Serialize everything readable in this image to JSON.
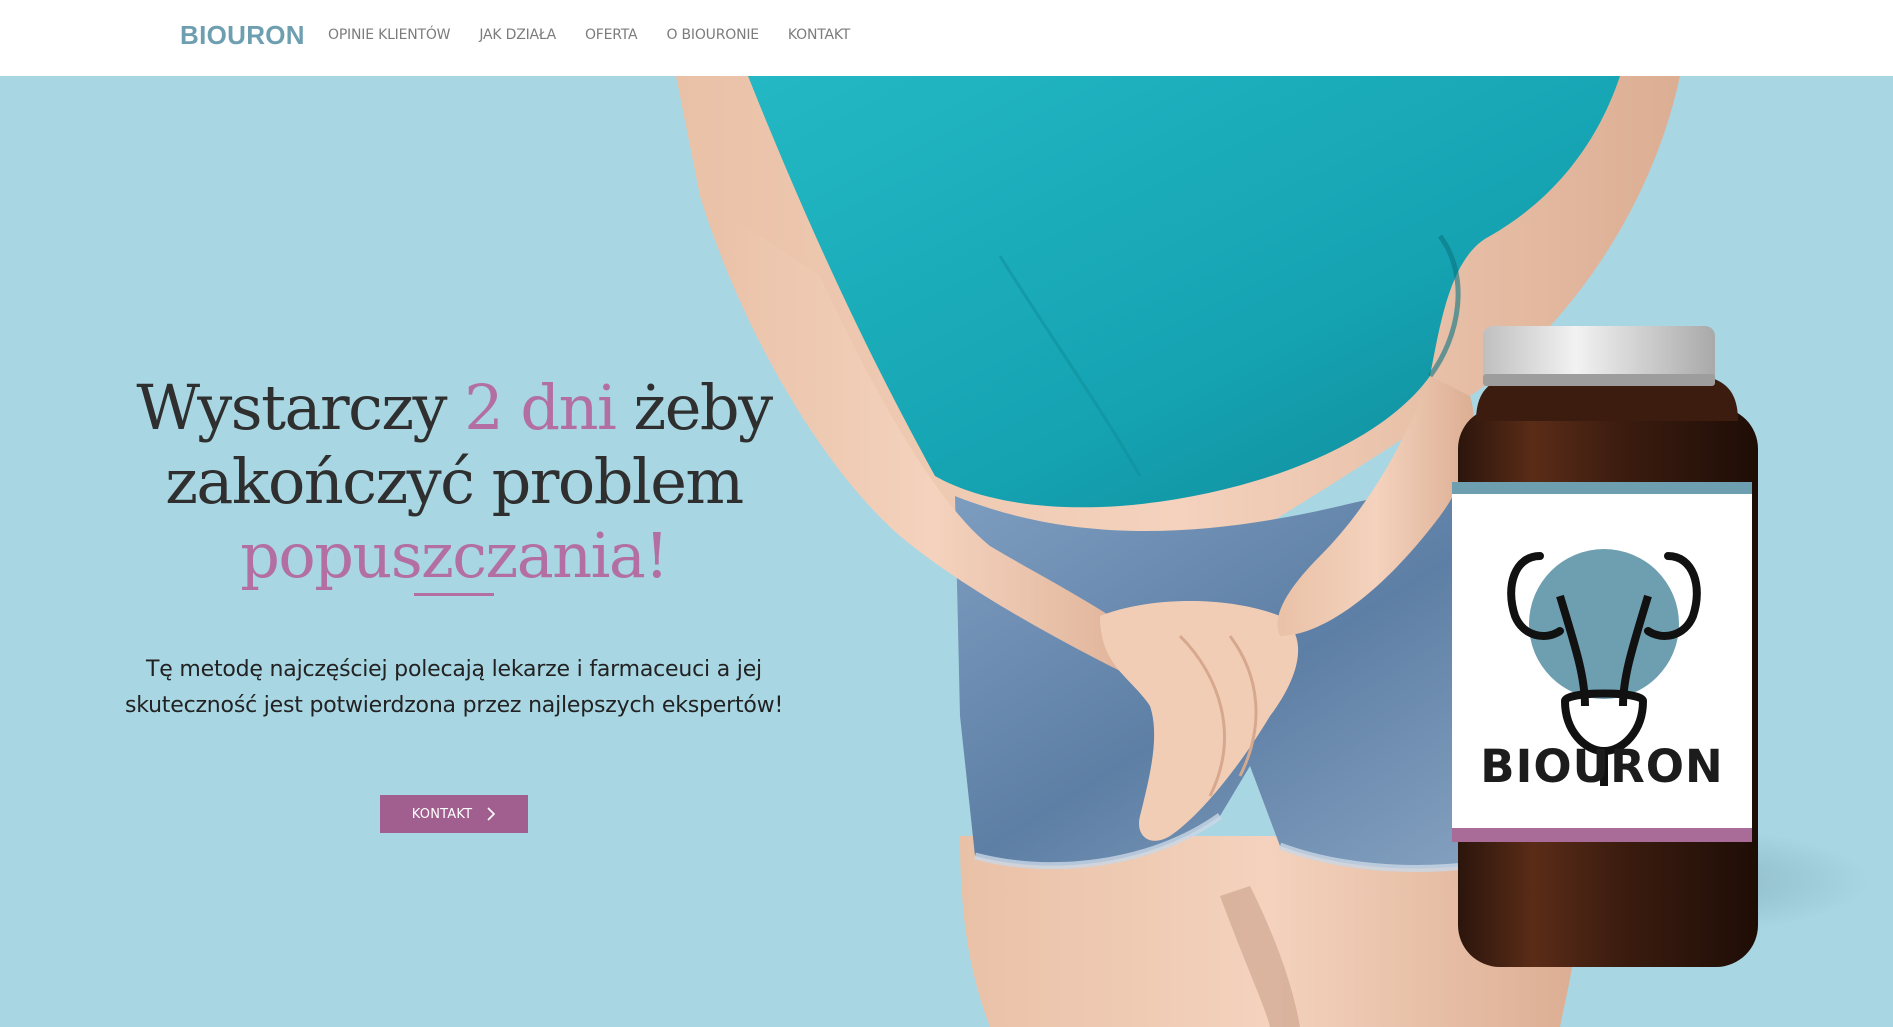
{
  "colors": {
    "brand": "#6e9fb1",
    "nav_text": "#7c7c7c",
    "hero_bg": "#a9d6e3",
    "heading_dark": "#2f2f2f",
    "accent": "#b36ea3",
    "button_bg": "#a05f8f",
    "button_text": "#ffffff",
    "body_text": "#222222"
  },
  "header": {
    "brand": "BIOURON",
    "nav": [
      {
        "label": "OPINIE KLIENTÓW"
      },
      {
        "label": "JAK DZIAŁA"
      },
      {
        "label": "OFERTA"
      },
      {
        "label": "O BIOURONIE"
      },
      {
        "label": "KONTAKT"
      }
    ]
  },
  "hero": {
    "headline": {
      "part1": "Wystarczy ",
      "highlight1": "2 dni",
      "part2": " żeby zakończyć problem ",
      "highlight2": "popuszczania!"
    },
    "subtext": "Tę metodę najczęściej polecają lekarze i farmaceuci a jej skuteczność jest potwierdzona przez najlepszych ekspertów!",
    "cta_label": "KONTAKT",
    "cta_icon": "chevron-right-icon",
    "product": {
      "label": "BIOURON",
      "icon": "urinary-system-icon"
    },
    "image": "woman-holding-crotch-photo"
  }
}
